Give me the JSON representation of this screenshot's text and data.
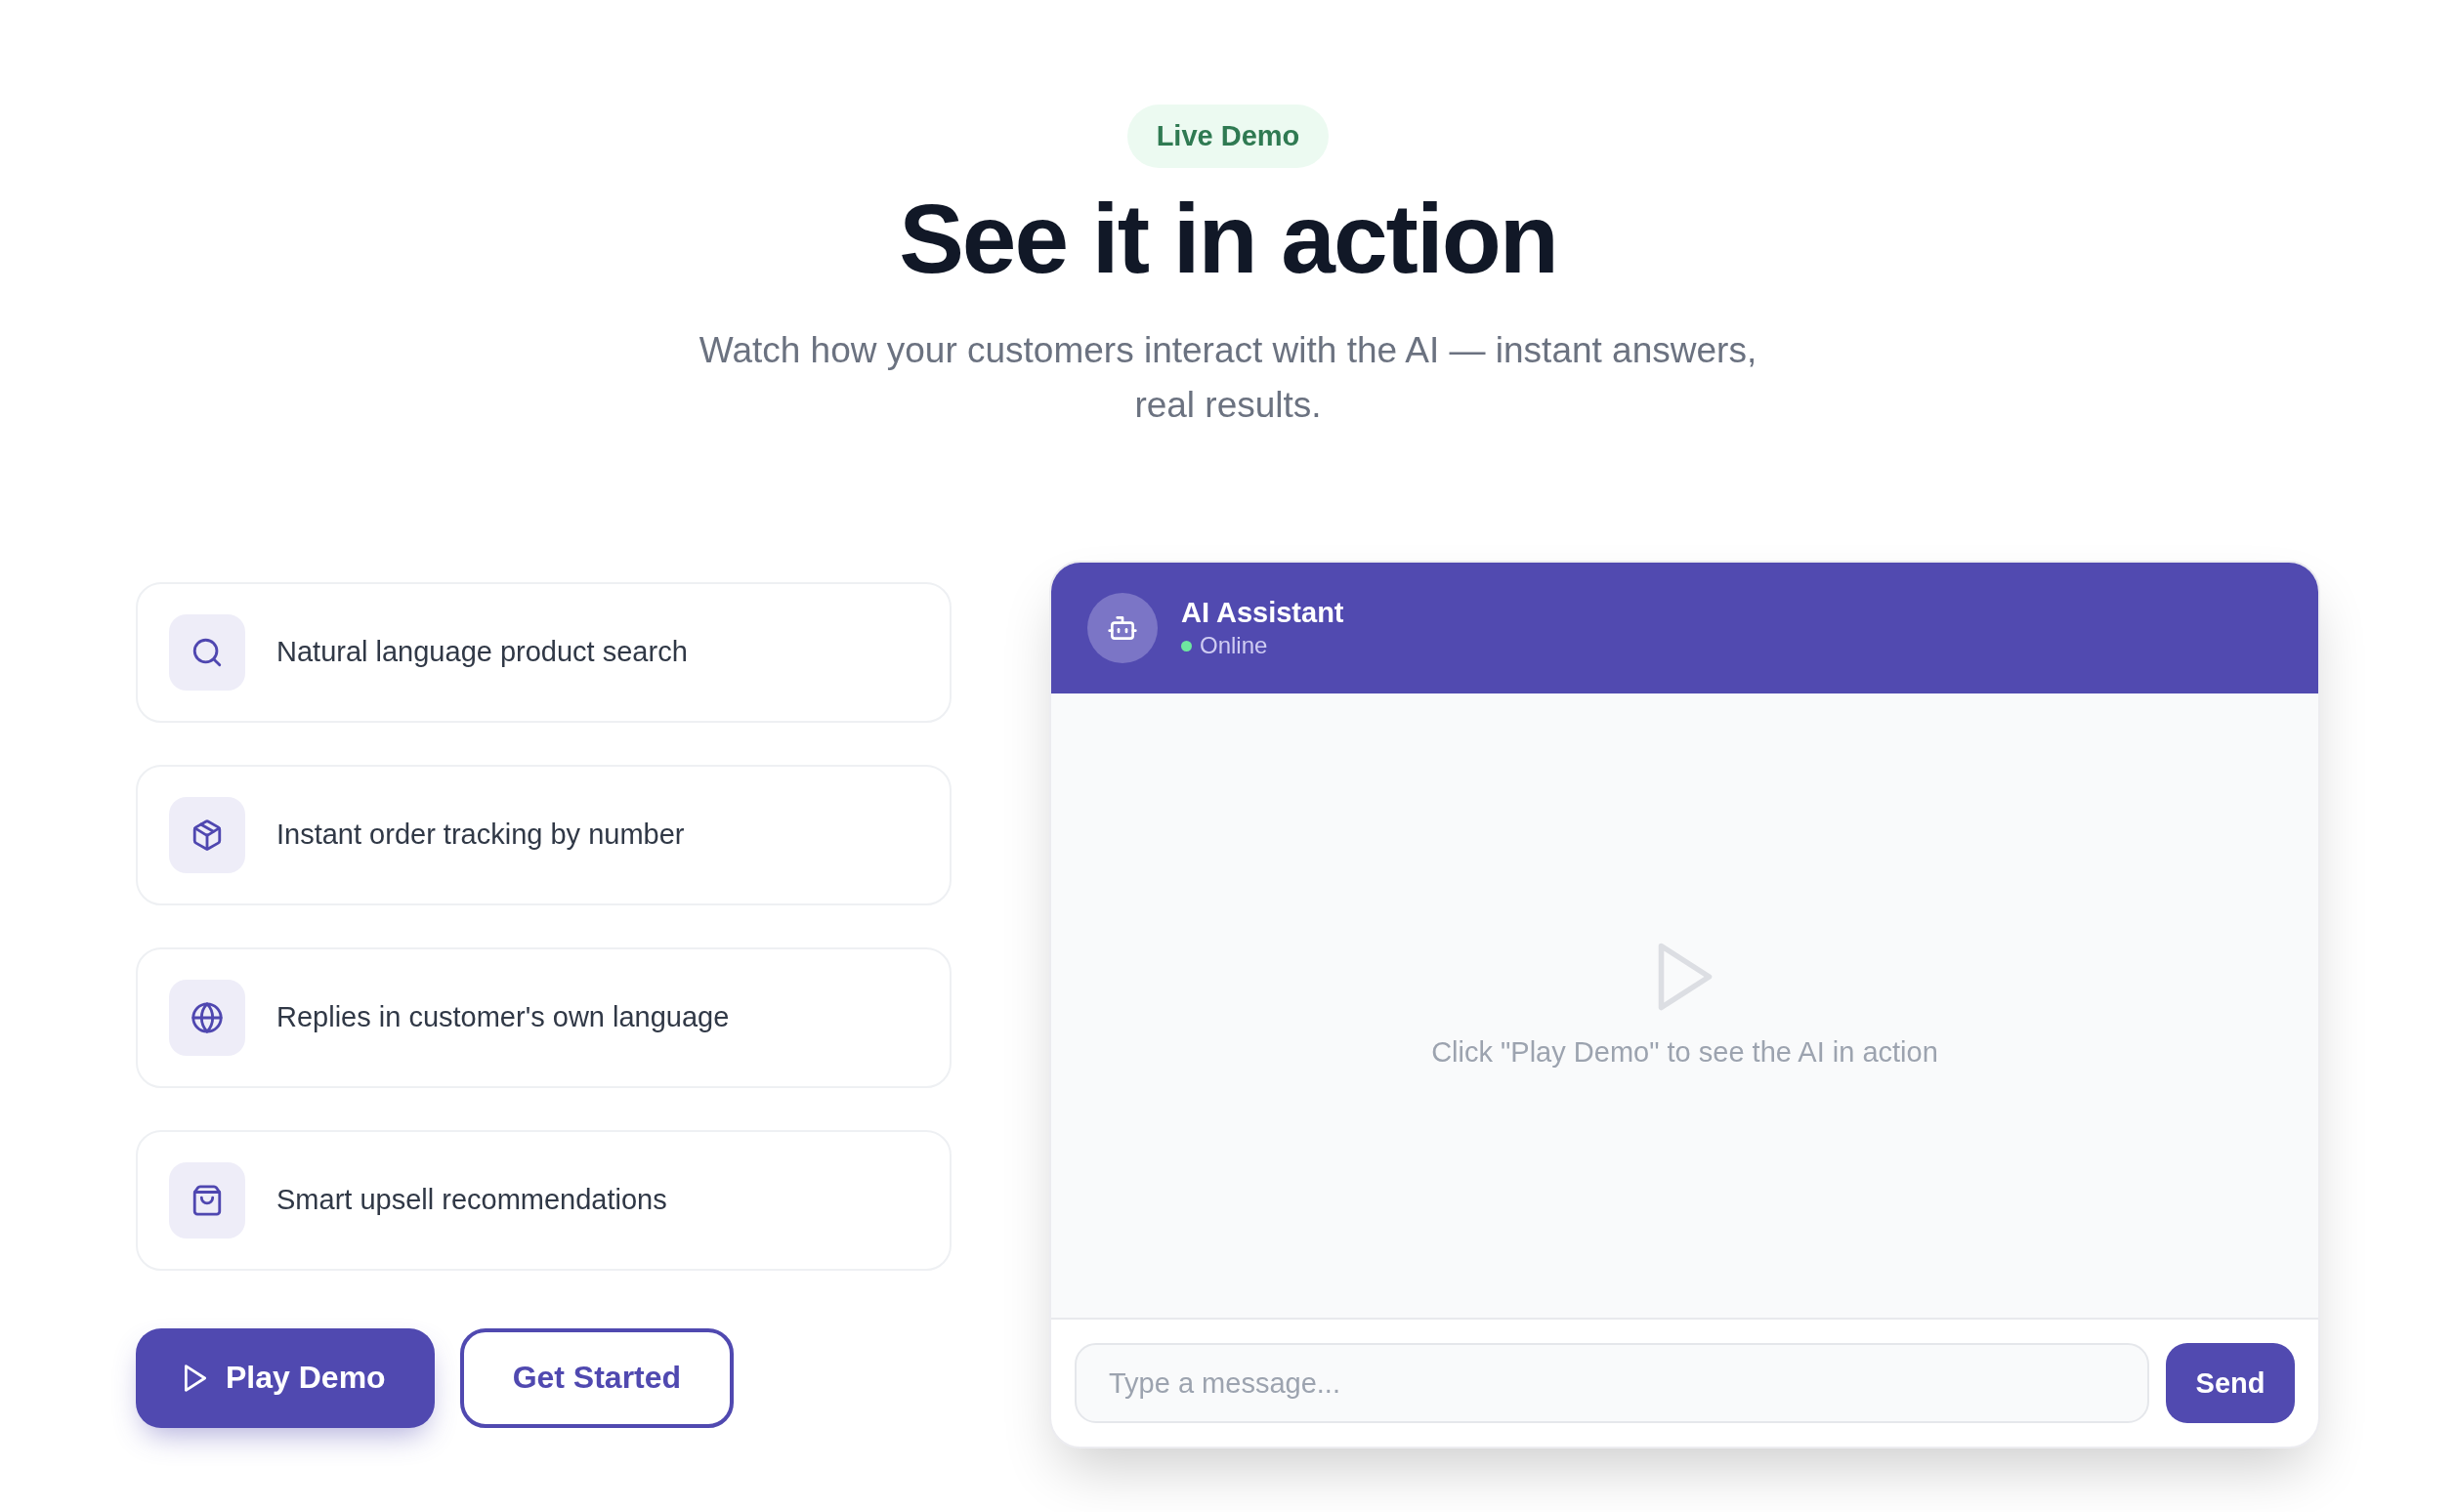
{
  "tag": {
    "label": "Live Demo"
  },
  "title": "See it in action",
  "subtitle": "Watch how your customers interact with the AI — instant answers, real results.",
  "features": [
    {
      "kind": "search",
      "label": "Natural language product search"
    },
    {
      "kind": "package",
      "label": "Instant order tracking by number"
    },
    {
      "kind": "globe",
      "label": "Replies in customer's own language"
    },
    {
      "kind": "bag",
      "label": "Smart upsell recommendations"
    }
  ],
  "actions": [
    {
      "kind": "primary",
      "label": "Play Demo"
    },
    {
      "kind": "outline",
      "label": "Get Started"
    }
  ],
  "chat": {
    "assistant_name": "AI Assistant",
    "status": "Online",
    "online": true,
    "empty_hint": "Click \"Play Demo\" to see the AI in action",
    "input": {
      "placeholder": "Type a message..."
    },
    "send_label": "Send"
  }
}
